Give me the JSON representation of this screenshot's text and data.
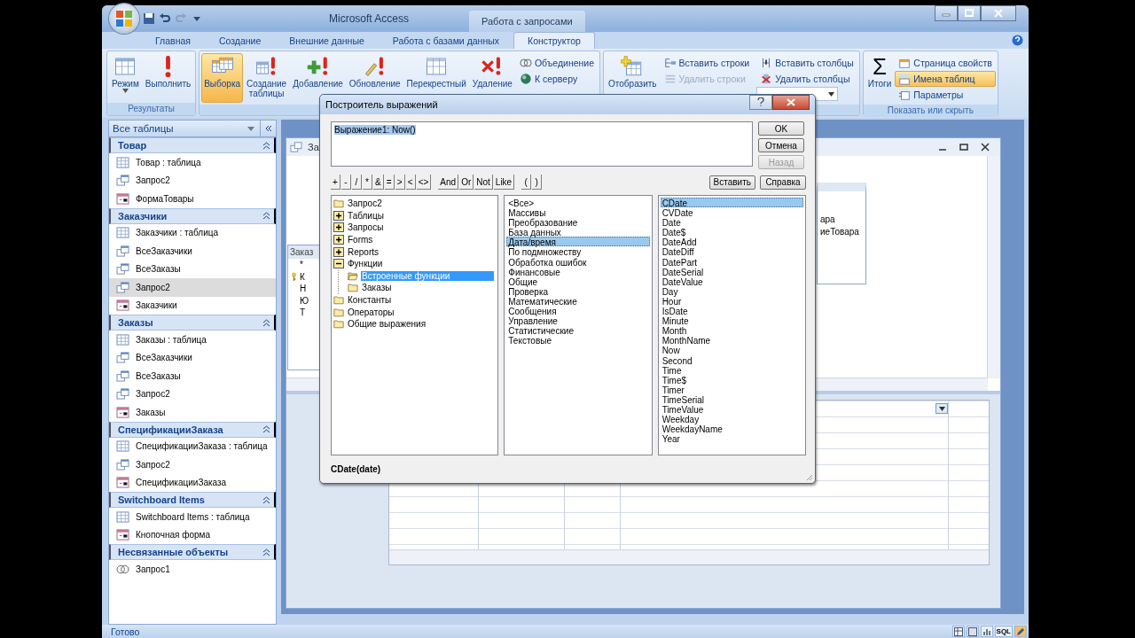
{
  "app": {
    "title": "Microsoft Access",
    "context_tab": "Работа с запросами"
  },
  "tabs": [
    {
      "label": "Главная",
      "selected": false
    },
    {
      "label": "Создание",
      "selected": false
    },
    {
      "label": "Внешние данные",
      "selected": false
    },
    {
      "label": "Работа с базами данных",
      "selected": false
    },
    {
      "label": "Конструктор",
      "selected": true
    }
  ],
  "ribbon_groups": [
    {
      "label": "Результаты",
      "large": [
        {
          "label": "Режим",
          "dropdown": true,
          "selected": false
        },
        {
          "label": "Выполнить",
          "dropdown": false,
          "selected": false
        }
      ]
    },
    {
      "large": [
        {
          "label": "Выборка",
          "dropdown": false,
          "selected": true
        },
        {
          "label": "Создание таблицы",
          "dropdown": false,
          "selected": false
        },
        {
          "label": "Добавление",
          "dropdown": false,
          "selected": false
        },
        {
          "label": "Обновление",
          "dropdown": false,
          "selected": false
        },
        {
          "label": "Перекрестный",
          "dropdown": false,
          "selected": false
        },
        {
          "label": "Удаление",
          "dropdown": false,
          "selected": false
        }
      ],
      "small": [
        {
          "label": "Объединение",
          "disabled": false,
          "selected": false
        },
        {
          "label": "К серверу",
          "disabled": false,
          "selected": false
        }
      ]
    },
    {
      "large": [
        {
          "label": "Отобразить",
          "dropdown": false,
          "selected": false
        }
      ],
      "small": [
        {
          "label": "Вставить строки",
          "disabled": false,
          "selected": false
        },
        {
          "label": "Удалить строки",
          "disabled": true,
          "selected": false
        },
        {
          "label": "Вставить столбцы",
          "disabled": false,
          "selected": false
        },
        {
          "label": "Удалить столбцы",
          "disabled": false,
          "selected": false
        }
      ],
      "combo": true
    },
    {
      "label": "Показать или скрыть",
      "large": [
        {
          "label": "Итоги",
          "glyph": "Σ",
          "dropdown": false,
          "selected": false
        }
      ],
      "small": [
        {
          "label": "Страница свойств",
          "disabled": false,
          "selected": false
        },
        {
          "label": "Имена таблиц",
          "disabled": false,
          "selected": true
        },
        {
          "label": "Параметры",
          "disabled": false,
          "selected": false
        }
      ]
    }
  ],
  "nav": {
    "title": "Все таблицы",
    "groups": [
      {
        "title": "Товар",
        "items": [
          {
            "label": "Товар : таблица",
            "kind": "table",
            "selected": false
          },
          {
            "label": "Запрос2",
            "kind": "query",
            "selected": false
          },
          {
            "label": "ФормаТовары",
            "kind": "form",
            "selected": false
          }
        ]
      },
      {
        "title": "Заказчики",
        "items": [
          {
            "label": "Заказчики : таблица",
            "kind": "table",
            "selected": false
          },
          {
            "label": "ВсеЗаказчики",
            "kind": "query",
            "selected": false
          },
          {
            "label": "ВсеЗаказы",
            "kind": "query",
            "selected": false
          },
          {
            "label": "Запрос2",
            "kind": "query",
            "selected": true
          },
          {
            "label": "Заказчики",
            "kind": "form",
            "selected": false
          }
        ]
      },
      {
        "title": "Заказы",
        "items": [
          {
            "label": "Заказы : таблица",
            "kind": "table",
            "selected": false
          },
          {
            "label": "ВсеЗаказчики",
            "kind": "query",
            "selected": false
          },
          {
            "label": "ВсеЗаказы",
            "kind": "query",
            "selected": false
          },
          {
            "label": "Запрос2",
            "kind": "query",
            "selected": false
          },
          {
            "label": "Заказы",
            "kind": "form",
            "selected": false
          }
        ]
      },
      {
        "title": "СпецификацииЗаказа",
        "items": [
          {
            "label": "СпецификацииЗаказа : таблица",
            "kind": "table",
            "selected": false
          },
          {
            "label": "Запрос2",
            "kind": "query",
            "selected": false
          },
          {
            "label": "СпецификацииЗаказа",
            "kind": "form",
            "selected": false
          }
        ]
      },
      {
        "title": "Switchboard Items",
        "items": [
          {
            "label": "Switchboard Items : таблица",
            "kind": "table",
            "selected": false
          },
          {
            "label": "Кнопочная форма",
            "kind": "form",
            "selected": false
          }
        ]
      },
      {
        "title": "Несвязанные объекты",
        "items": [
          {
            "label": "Запрос1",
            "kind": "union",
            "selected": false
          }
        ]
      }
    ]
  },
  "query_window": {
    "title": "За",
    "left_table": {
      "title": "Заказ",
      "fields": [
        {
          "label": "*",
          "key": false
        },
        {
          "label": "К",
          "key": true
        },
        {
          "label": "Н",
          "key": false
        },
        {
          "label": "Ю",
          "key": false
        },
        {
          "label": "Т",
          "key": false
        }
      ]
    },
    "right_table": {
      "fields": [
        "ара",
        "иеТовара"
      ]
    }
  },
  "dialog": {
    "title": "Построитель выражений",
    "expression": "Выражение1: Now()",
    "side_buttons": [
      {
        "label": "OK",
        "disabled": false
      },
      {
        "label": "Отмена",
        "disabled": false
      },
      {
        "label": "Назад",
        "disabled": true
      }
    ],
    "operators": [
      "+",
      "-",
      "/",
      "*",
      "&",
      "=",
      ">",
      "<",
      "<>",
      "And",
      "Or",
      "Not",
      "Like",
      "(",
      ")"
    ],
    "action_buttons": [
      "Вставить",
      "Справка"
    ],
    "tree": [
      {
        "label": "Запрос2",
        "selected": false
      },
      {
        "label": "Таблицы",
        "expanded": false,
        "selected": false
      },
      {
        "label": "Запросы",
        "expanded": false,
        "selected": false
      },
      {
        "label": "Forms",
        "expanded": false,
        "selected": false
      },
      {
        "label": "Reports",
        "expanded": false,
        "selected": false
      },
      {
        "label": "Функции",
        "expanded": true,
        "selected": false,
        "children": [
          {
            "label": "Встроенные функции",
            "selected": true
          },
          {
            "label": "Заказы",
            "selected": false
          }
        ]
      },
      {
        "label": "Константы",
        "selected": false
      },
      {
        "label": "Операторы",
        "selected": false
      },
      {
        "label": "Общие выражения",
        "selected": false
      }
    ],
    "categories": [
      {
        "label": "<Все>",
        "selected": false
      },
      {
        "label": "Массивы",
        "selected": false
      },
      {
        "label": "Преобразование",
        "selected": false
      },
      {
        "label": "База данных",
        "selected": false
      },
      {
        "label": "Дата/время",
        "selected": true
      },
      {
        "label": "По подмножеству",
        "selected": false
      },
      {
        "label": "Обработка ошибок",
        "selected": false
      },
      {
        "label": "Финансовые",
        "selected": false
      },
      {
        "label": "Общие",
        "selected": false
      },
      {
        "label": "Проверка",
        "selected": false
      },
      {
        "label": "Математические",
        "selected": false
      },
      {
        "label": "Сообщения",
        "selected": false
      },
      {
        "label": "Управление",
        "selected": false
      },
      {
        "label": "Статистические",
        "selected": false
      },
      {
        "label": "Текстовые",
        "selected": false
      }
    ],
    "functions": [
      {
        "label": "CDate",
        "selected": true
      },
      {
        "label": "CVDate",
        "selected": false
      },
      {
        "label": "Date",
        "selected": false
      },
      {
        "label": "Date$",
        "selected": false
      },
      {
        "label": "DateAdd",
        "selected": false
      },
      {
        "label": "DateDiff",
        "selected": false
      },
      {
        "label": "DatePart",
        "selected": false
      },
      {
        "label": "DateSerial",
        "selected": false
      },
      {
        "label": "DateValue",
        "selected": false
      },
      {
        "label": "Day",
        "selected": false
      },
      {
        "label": "Hour",
        "selected": false
      },
      {
        "label": "IsDate",
        "selected": false
      },
      {
        "label": "Minute",
        "selected": false
      },
      {
        "label": "Month",
        "selected": false
      },
      {
        "label": "MonthName",
        "selected": false
      },
      {
        "label": "Now",
        "selected": false
      },
      {
        "label": "Second",
        "selected": false
      },
      {
        "label": "Time",
        "selected": false
      },
      {
        "label": "Time$",
        "selected": false
      },
      {
        "label": "Timer",
        "selected": false
      },
      {
        "label": "TimeSerial",
        "selected": false
      },
      {
        "label": "TimeValue",
        "selected": false
      },
      {
        "label": "Weekday",
        "selected": false
      },
      {
        "label": "WeekdayName",
        "selected": false
      },
      {
        "label": "Year",
        "selected": false
      }
    ],
    "syntax": "CDate(date)"
  },
  "status_bar": {
    "text": "Готово",
    "sql_label": "SQL"
  }
}
